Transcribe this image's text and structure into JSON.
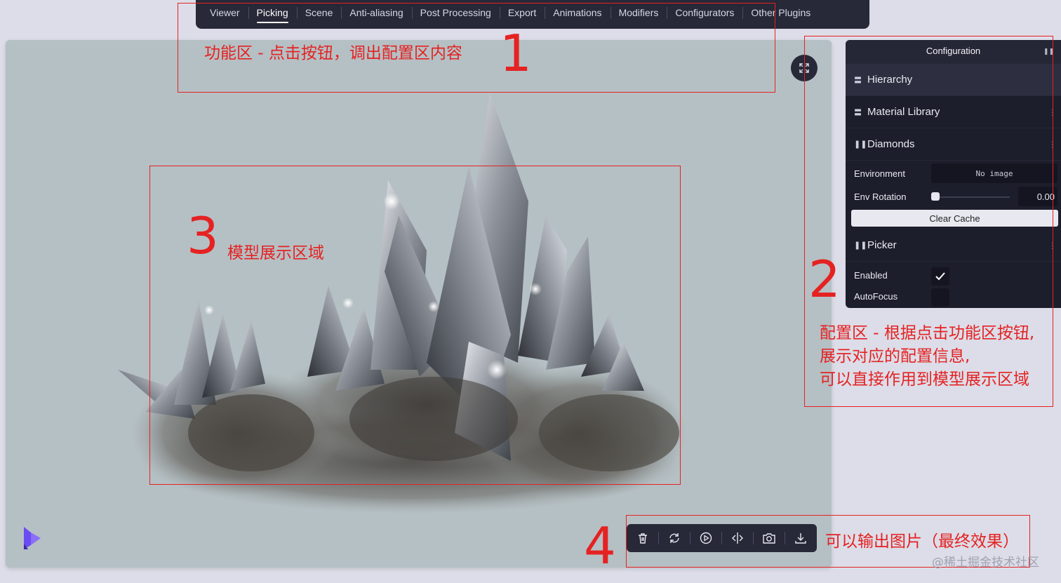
{
  "nav": {
    "tabs": [
      "Viewer",
      "Picking",
      "Scene",
      "Anti-aliasing",
      "Post Processing",
      "Export",
      "Animations",
      "Modifiers",
      "Configurators",
      "Other Plugins"
    ],
    "active": "Picking"
  },
  "config": {
    "title": "Configuration",
    "sections": {
      "hierarchy": "Hierarchy",
      "material_library": "Material Library",
      "diamonds": "Diamonds",
      "picker": "Picker"
    },
    "environment": {
      "label": "Environment",
      "value": "No image"
    },
    "env_rotation": {
      "label": "Env Rotation",
      "value": "0.00"
    },
    "clear_cache": "Clear Cache",
    "enabled": {
      "label": "Enabled",
      "checked": true
    },
    "autofocus": {
      "label": "AutoFocus",
      "checked": false
    }
  },
  "toolbar": {
    "icons": [
      "trash-icon",
      "reset-icon",
      "play-icon",
      "split-icon",
      "camera-icon",
      "download-icon"
    ]
  },
  "annotations": {
    "a1_num": "1",
    "a1_text": "功能区 - 点击按钮，调出配置区内容",
    "a2_num": "2",
    "a2_line1": "配置区 - 根据点击功能区按钮,",
    "a2_line2": "展示对应的配置信息,",
    "a2_line3": "可以直接作用到模型展示区域",
    "a3_num": "3",
    "a3_text": "模型展示区域",
    "a4_num": "4",
    "a4_text": "可以输出图片（最终效果）"
  },
  "watermark": "@稀土掘金技术社区",
  "colors": {
    "panel": "#1d1e2b",
    "nav": "#272838",
    "viewport": "#b5c0c4",
    "annotation": "#e52222"
  }
}
